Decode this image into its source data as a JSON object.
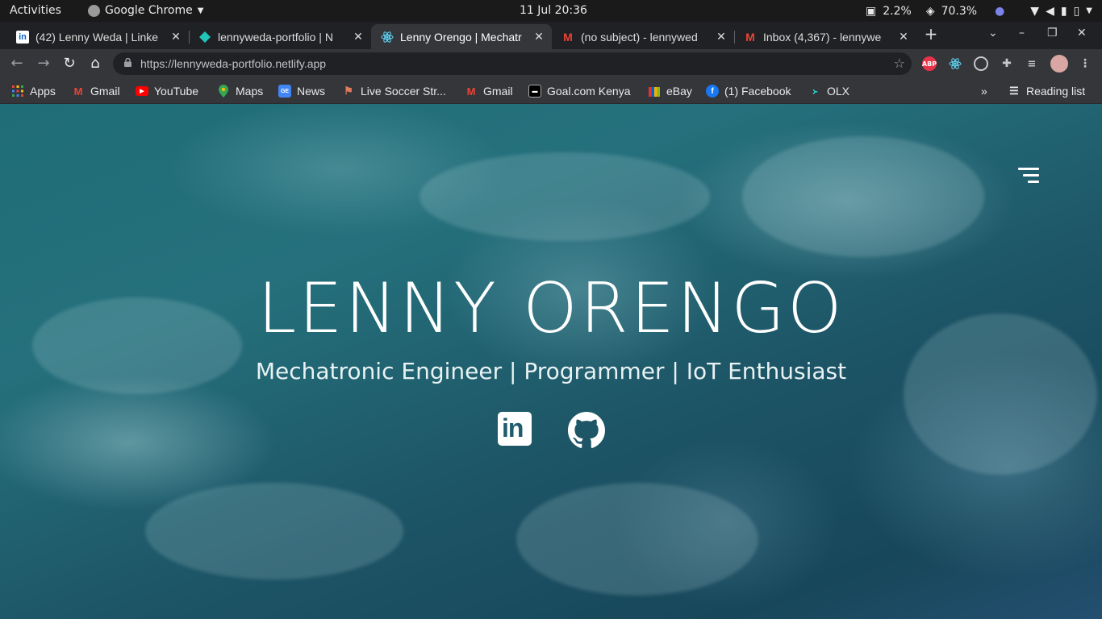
{
  "system": {
    "activities": "Activities",
    "app_name": "Google Chrome",
    "clock": "11 Jul  20:36",
    "cpu": "2.2%",
    "battery": "70.3%"
  },
  "tabs": [
    {
      "title": "(42) Lenny Weda | Linke",
      "favicon": "linkedin-icon",
      "active": false
    },
    {
      "title": "lennyweda-portfolio | N",
      "favicon": "netlify-icon",
      "active": false
    },
    {
      "title": "Lenny Orengo | Mechatr",
      "favicon": "react-icon",
      "active": true
    },
    {
      "title": "(no subject) - lennywed",
      "favicon": "gmail-icon",
      "active": false
    },
    {
      "title": "Inbox (4,367) - lennywe",
      "favicon": "gmail-icon",
      "active": false
    }
  ],
  "toolbar": {
    "url": "https://lennyweda-portfolio.netlify.app"
  },
  "bookmarks": {
    "items": [
      {
        "label": "Apps",
        "icon": "apps-grid-icon"
      },
      {
        "label": "Gmail",
        "icon": "gmail-icon"
      },
      {
        "label": "YouTube",
        "icon": "youtube-icon"
      },
      {
        "label": "Maps",
        "icon": "maps-icon"
      },
      {
        "label": "News",
        "icon": "news-icon"
      },
      {
        "label": "Live Soccer Str...",
        "icon": "soccer-icon"
      },
      {
        "label": "Gmail",
        "icon": "gmail-icon"
      },
      {
        "label": "Goal.com Kenya",
        "icon": "goal-icon"
      },
      {
        "label": "eBay",
        "icon": "ebay-icon"
      },
      {
        "label": "(1) Facebook",
        "icon": "facebook-icon"
      },
      {
        "label": "OLX",
        "icon": "olx-icon"
      }
    ],
    "reading_list": "Reading list"
  },
  "hero": {
    "name": "LENNY ORENGO",
    "tagline": "Mechatronic Engineer | Programmer | IoT Enthusiast"
  },
  "colors": {
    "ocean_dark": "#17475a",
    "ocean_teal": "#1f6d77",
    "text": "#ffffff"
  }
}
